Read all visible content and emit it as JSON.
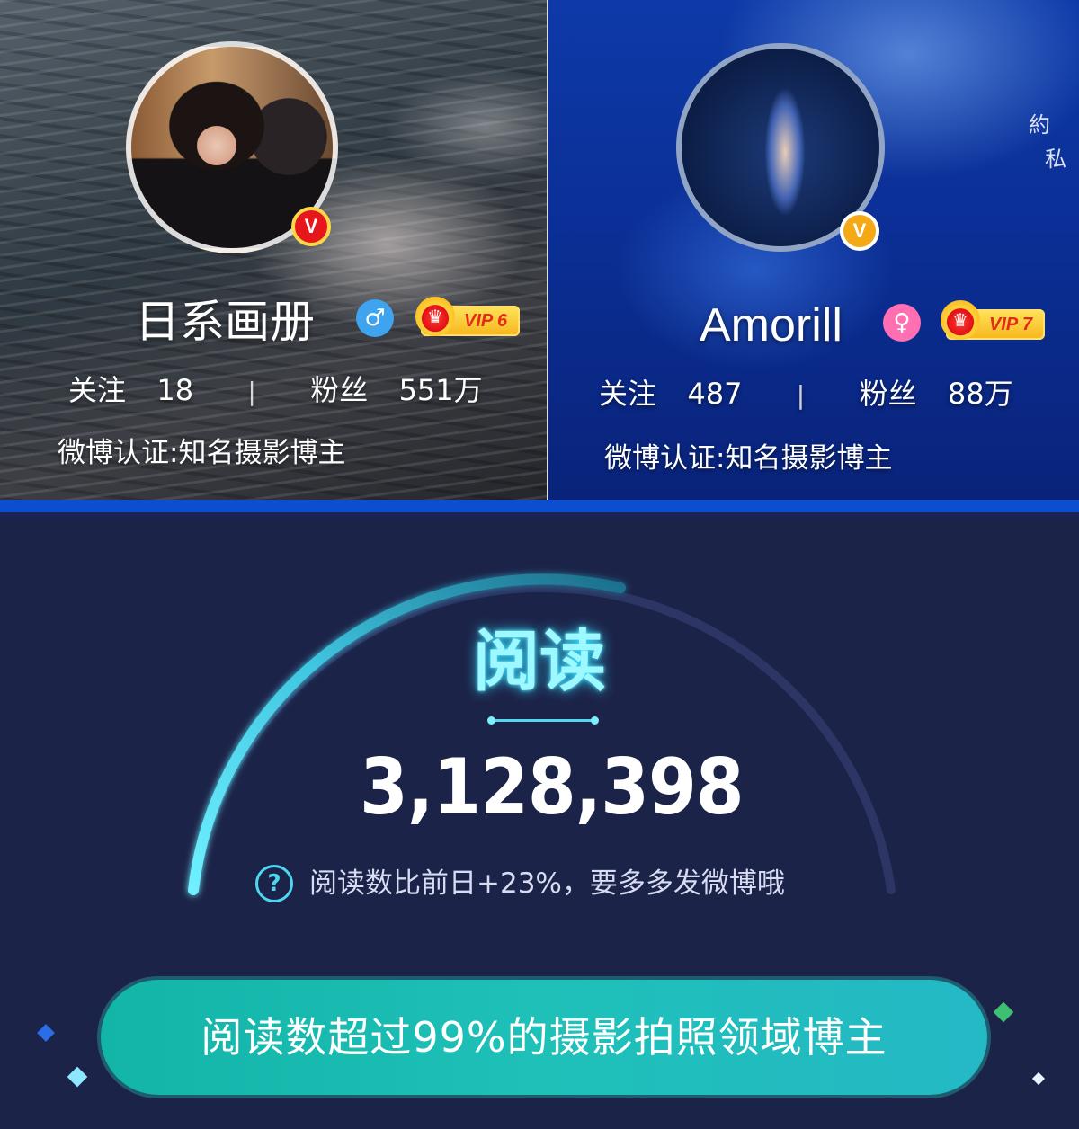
{
  "profiles": [
    {
      "nickname": "日系画册",
      "gender_symbol": "♂",
      "vip_label": "VIP 6",
      "verified_mark": "V",
      "follow_label": "关注",
      "follow_count": "18",
      "fans_label": "粉丝",
      "fans_count": "551万",
      "separator": "|",
      "verification": "微博认证:知名摄影博主"
    },
    {
      "nickname": "Amorill",
      "gender_symbol": "♀",
      "vip_label": "VIP 7",
      "verified_mark": "V",
      "follow_label": "关注",
      "follow_count": "487",
      "fans_label": "粉丝",
      "fans_count": "88万",
      "separator": "|",
      "verification": "微博认证:知名摄影博主",
      "side_text": [
        "約",
        "私"
      ]
    }
  ],
  "reads": {
    "title": "阅读",
    "value": "3,128,398",
    "help_symbol": "?",
    "hint": "阅读数比前日+23%，要多多发微博哦",
    "banner": "阅读数超过99%的摄影拍照领域博主"
  },
  "colors": {
    "panel_bg": "#1c2348",
    "accent_cyan": "#4fd6ef",
    "banner_green": "#1ec0b8",
    "vip_gold": "#f7b51c",
    "verified_red": "#e6161d",
    "verified_orange": "#f6a916"
  }
}
